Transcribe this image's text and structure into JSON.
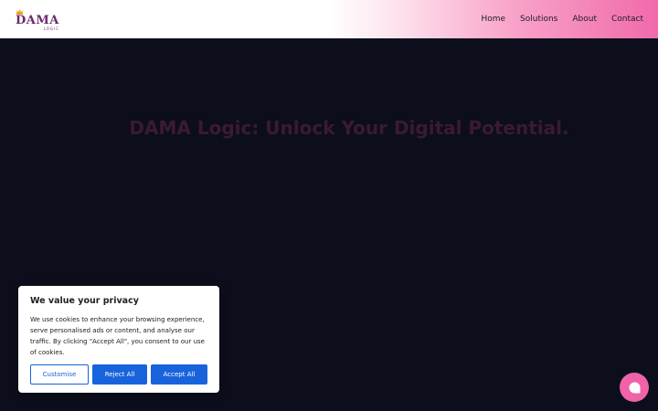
{
  "header": {
    "logo": {
      "main": "DAMA",
      "sub": "LOGIC"
    },
    "nav": [
      "Home",
      "Solutions",
      "About",
      "Contact"
    ]
  },
  "hero": {
    "title": "DAMA Logic: Unlock Your Digital Potential."
  },
  "cookie": {
    "title": "We value your privacy",
    "text": "We use cookies to enhance your browsing experience, serve personalised ads or content, and analyse our traffic. By clicking \"Accept All\", you consent to our use of cookies.",
    "buttons": {
      "customise": "Customise",
      "reject": "Reject All",
      "accept": "Accept All"
    }
  },
  "colors": {
    "brand_pink": "#f063a8",
    "brand_purple": "#6a2a6d",
    "consent_blue": "#1863dc",
    "page_bg": "#0c0e1c"
  },
  "chat": {
    "icon": "chat-bubble-icon"
  }
}
